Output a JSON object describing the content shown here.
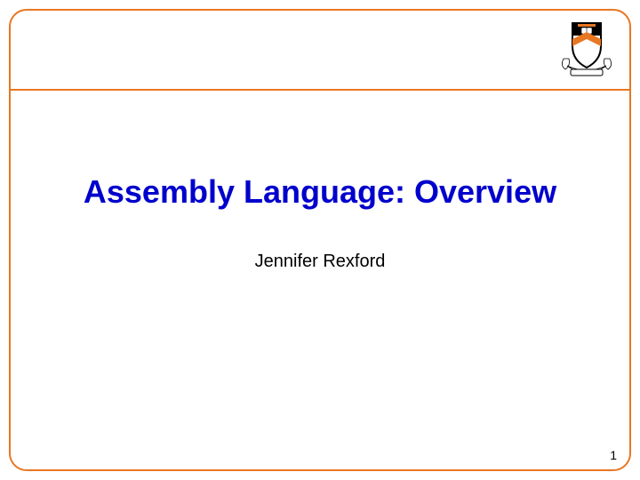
{
  "slide": {
    "title": "Assembly Language: Overview",
    "author": "Jennifer Rexford",
    "page_number": "1"
  },
  "logo": {
    "name": "princeton-shield"
  },
  "colors": {
    "accent": "#E87722",
    "title_color": "#0000CC"
  }
}
